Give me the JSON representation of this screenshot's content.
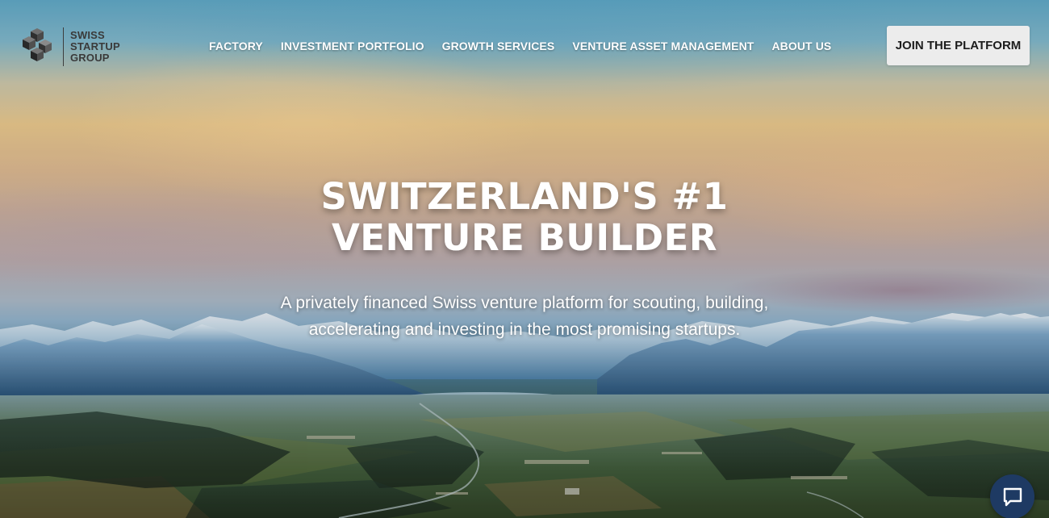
{
  "brand": {
    "logo_lines": [
      "SWISS",
      "STARTUP",
      "GROUP"
    ]
  },
  "nav": {
    "items": [
      {
        "label": "FACTORY"
      },
      {
        "label": "INVESTMENT PORTFOLIO"
      },
      {
        "label": "GROWTH SERVICES"
      },
      {
        "label": "VENTURE ASSET MANAGEMENT"
      },
      {
        "label": "ABOUT US"
      }
    ],
    "cta_label": "JOIN THE PLATFORM"
  },
  "hero": {
    "headline_line1": "SWITZERLAND'S #1",
    "headline_line2": "VENTURE BUILDER",
    "subheadline": "A privately financed Swiss venture platform for scouting, building, accelerating and investing in the most promising startups."
  },
  "icons": {
    "logo": "cube-logo-icon",
    "chat": "chat-bubble-icon"
  },
  "colors": {
    "nav_text": "#ffffff",
    "cta_background": "#ececec",
    "cta_text": "#1d1d1d",
    "chat_button": "#1e3a63"
  }
}
